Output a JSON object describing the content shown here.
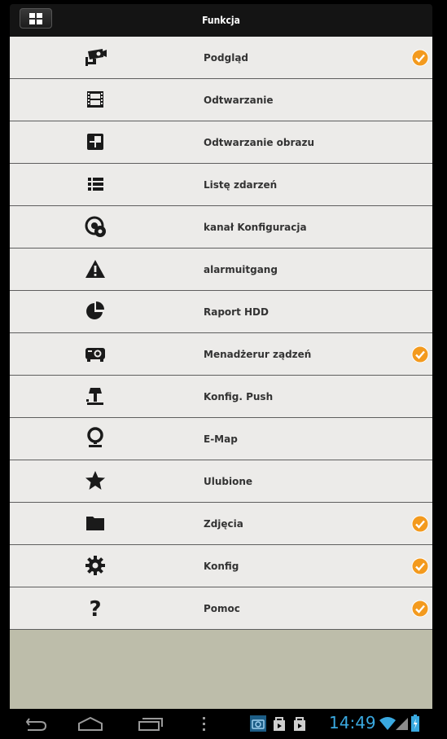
{
  "header": {
    "title": "Funkcja"
  },
  "items": [
    {
      "label": "Podgląd",
      "icon": "cctv-camera-icon",
      "checked": true
    },
    {
      "label": "Odtwarzanie",
      "icon": "film-strip-icon",
      "checked": false
    },
    {
      "label": "Odtwarzanie obrazu",
      "icon": "multi-view-icon",
      "checked": false
    },
    {
      "label": "Listę zdarzeń",
      "icon": "list-icon",
      "checked": false
    },
    {
      "label": "kanał Konfiguracja",
      "icon": "channel-config-icon",
      "checked": false
    },
    {
      "label": "alarmuitgang",
      "icon": "warning-icon",
      "checked": false
    },
    {
      "label": "Raport HDD",
      "icon": "pie-chart-icon",
      "checked": false
    },
    {
      "label": "Menadżerur ządzeń",
      "icon": "projector-icon",
      "checked": true
    },
    {
      "label": "Konfig. Push",
      "icon": "push-icon",
      "checked": false
    },
    {
      "label": "E-Map",
      "icon": "map-pin-icon",
      "checked": false
    },
    {
      "label": "Ulubione",
      "icon": "star-icon",
      "checked": false
    },
    {
      "label": "Zdjęcia",
      "icon": "folder-icon",
      "checked": true
    },
    {
      "label": "Konfig",
      "icon": "gear-icon",
      "checked": true
    },
    {
      "label": "Pomoc",
      "icon": "help-icon",
      "checked": true
    }
  ],
  "status_bar": {
    "time": "14:49"
  },
  "colors": {
    "accent_check": "#f39a1e",
    "clock": "#3aa9e0",
    "list_bg": "#ecebe9",
    "empty_area": "#bdbdaa"
  }
}
